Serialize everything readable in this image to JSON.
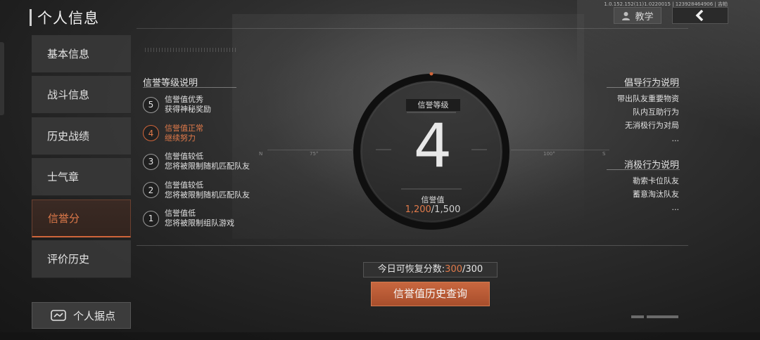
{
  "header": {
    "title": "个人信息",
    "version": "1.0.152.152(11)1.0220015 | 123928464906 | 吉帕",
    "help_label": "教学"
  },
  "sidebar": {
    "items": [
      {
        "label": "基本信息"
      },
      {
        "label": "战斗信息"
      },
      {
        "label": "历史战绩"
      },
      {
        "label": "士气章"
      },
      {
        "label": "信誉分",
        "active": true
      },
      {
        "label": "评价历史"
      }
    ],
    "base_button": "个人据点"
  },
  "credit_levels": {
    "title": "信誉等级说明",
    "levels": [
      {
        "num": "5",
        "line1": "信誉值优秀",
        "line2": "获得神秘奖励"
      },
      {
        "num": "4",
        "line1": "信誉值正常",
        "line2": "继续努力",
        "active": true
      },
      {
        "num": "3",
        "line1": "信誉值较低",
        "line2": "您将被限制随机匹配队友"
      },
      {
        "num": "2",
        "line1": "信誉值较低",
        "line2": "您将被限制随机匹配队友"
      },
      {
        "num": "1",
        "line1": "信誉值低",
        "line2": "您将被限制组队游戏"
      }
    ]
  },
  "dial": {
    "level_label": "信誉等级",
    "level": "4",
    "value_label": "信誉值",
    "current": "1,200",
    "max": "/1,500",
    "scale_marks": [
      "N",
      "75°",
      "100°",
      "S"
    ]
  },
  "guide": {
    "title": "倡导行为说明",
    "items": [
      "带出队友重要物资",
      "队内互助行为",
      "无消极行为对局",
      "..."
    ]
  },
  "negative": {
    "title": "消极行为说明",
    "items": [
      "勒索卡位队友",
      "蓄意淘汰队友",
      "..."
    ]
  },
  "restore": {
    "label": "今日可恢复分数:",
    "current": "300",
    "max": "/300"
  },
  "history_button": "信誉值历史查询",
  "colors": {
    "accent": "#d0653a",
    "active_text": "#e07a4a"
  }
}
